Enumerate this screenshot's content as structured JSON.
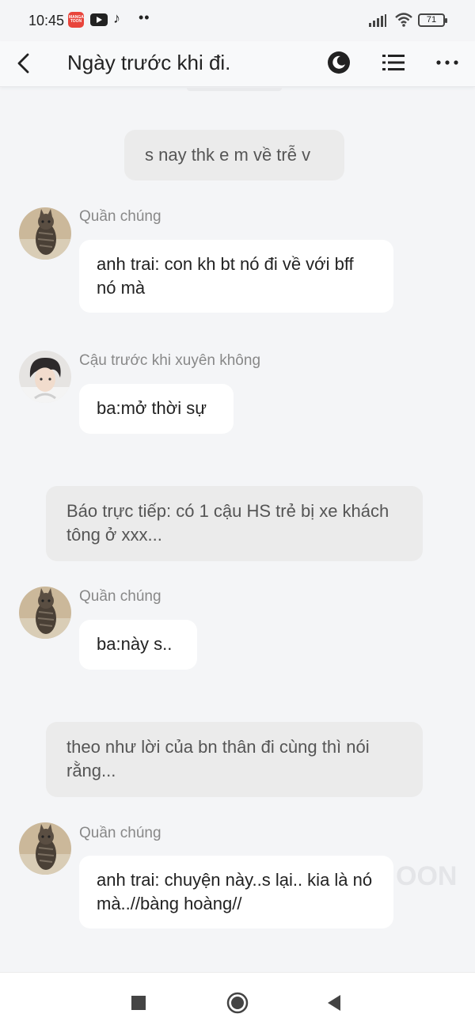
{
  "status_bar": {
    "time": "10:45",
    "tiktok_icon": "♪",
    "more": "••",
    "battery": "71"
  },
  "header": {
    "title": "Ngày trước khi đi."
  },
  "messages": [
    {
      "type": "narration",
      "text": "s nay thk e m về trễ v"
    },
    {
      "type": "dialogue",
      "speaker": "Quần chúng",
      "avatar": "cat-avatar",
      "text": "anh trai: con kh bt nó đi về với bff nó mà"
    },
    {
      "type": "dialogue",
      "speaker": "Cậu trước khi xuyên không",
      "avatar": "boy-avatar",
      "text": "ba:mở thời sự"
    },
    {
      "type": "narration",
      "text": "Báo trực tiếp: có 1 cậu HS trẻ bị xe khách tông ở xxx..."
    },
    {
      "type": "dialogue",
      "speaker": "Quần chúng",
      "avatar": "cat-avatar",
      "text": "ba:này s.."
    },
    {
      "type": "narration",
      "text": "theo như lời của bn thân đi cùng thì nói rằng..."
    },
    {
      "type": "dialogue",
      "speaker": "Quần chúng",
      "avatar": "cat-avatar",
      "text": "anh trai: chuyện này..s lại.. kia là nó mà..//bàng hoàng//"
    }
  ],
  "watermark": "OON",
  "colors": {
    "background": "#f4f5f7",
    "bubble": "#ffffff",
    "narration": "#ebebeb",
    "speaker": "#888888"
  }
}
